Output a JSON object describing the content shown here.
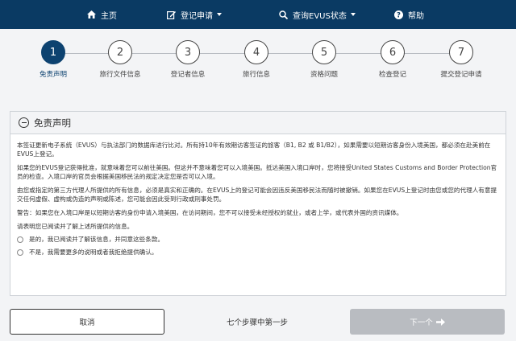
{
  "nav": {
    "home": "主页",
    "register": "登记申请",
    "status": "查询EVUS状态",
    "help": "帮助"
  },
  "steps": [
    {
      "number": "1",
      "label": "免责声明"
    },
    {
      "number": "2",
      "label": "旅行文件信息"
    },
    {
      "number": "3",
      "label": "登记者信息"
    },
    {
      "number": "4",
      "label": "旅行信息"
    },
    {
      "number": "5",
      "label": "资格问题"
    },
    {
      "number": "6",
      "label": "检查登记"
    },
    {
      "number": "7",
      "label": "提交登记申请"
    }
  ],
  "panel": {
    "title": "免责声明",
    "paragraphs": [
      "本签证更新电子系统（EVUS）与执法部门的数据库进行比对。所有持10年有效期访客签证的旅客（B1, B2 或 B1/B2），如果需要以短期访客身份入境美国，都必须在赴美前在EVUS上登记。",
      "如果您的EVUS登记获得批准，就意味着您可以前往美国。但这并不意味着您可以入境美国。抵达美国入境口岸时，您将接受United States Customs and Border Protection官员的检查。入境口岸的官员会根据美国移民法的规定决定您是否可以入境。",
      "由您或指定的第三方代理人所提供的所有信息，必须是真实和正确的。在EVUS上的登记可能会因违反美国移民法而随时被撤销。如果您在EVUS上登记时由您或您的代理人有意提交任何虚假、虚构或伪造的声明或陈述，您可能会因此受到行政或刑事处罚。",
      "警告：如果您在入境口岸是以短期访客的身份申请入境美国，在访问期间，您不可以接受未经授权的就业，或者上学，或代表外国的资讯媒体。"
    ],
    "prompt": "请表明您已阅读并了解上述所提供的信息。",
    "options": [
      "是的，我已阅读并了解该信息，并同意这些条款。",
      "不是，我需要更多的说明或者我拒绝提供确认。"
    ]
  },
  "footer": {
    "cancel": "取消",
    "step_count": "七个步骤中第一步",
    "next": "下一个"
  },
  "colors": {
    "nav_bg": "#0a3a63",
    "active_step": "#0d4270",
    "disabled_button": "#b9bcc1"
  }
}
